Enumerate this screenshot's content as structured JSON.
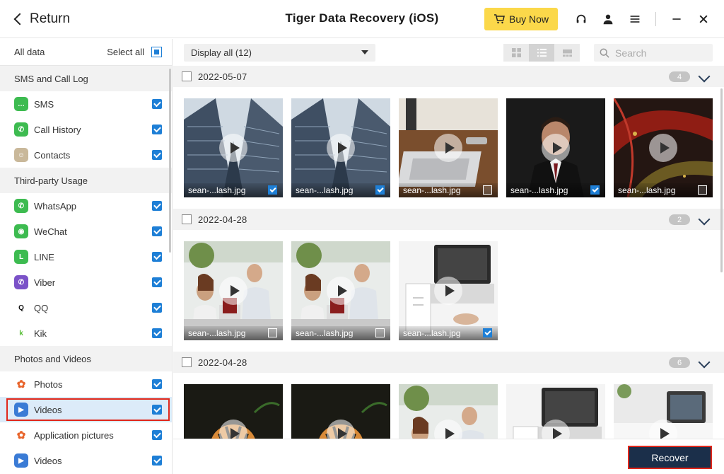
{
  "window": {
    "title": "Tiger Data Recovery (iOS)",
    "return_label": "Return",
    "buy_now_label": "Buy Now",
    "icons": [
      "headset-icon",
      "user-icon",
      "menu-icon",
      "minimize-icon",
      "close-icon"
    ]
  },
  "sidebar": {
    "all_data_label": "All data",
    "select_all_label": "Select all",
    "sections": [
      {
        "title": "SMS and Call Log",
        "items": [
          {
            "label": "SMS",
            "icon": "sms-icon",
            "color": "#3dbb50",
            "checked": true
          },
          {
            "label": "Call History",
            "icon": "phone-icon",
            "color": "#3dbb50",
            "checked": true
          },
          {
            "label": "Contacts",
            "icon": "contacts-icon",
            "color": "#c9b89a",
            "checked": true
          }
        ]
      },
      {
        "title": "Third-party Usage",
        "items": [
          {
            "label": "WhatsApp",
            "icon": "whatsapp-icon",
            "color": "#3dbb50",
            "checked": true
          },
          {
            "label": "WeChat",
            "icon": "wechat-icon",
            "color": "#3dbb50",
            "checked": true
          },
          {
            "label": "LINE",
            "icon": "line-icon",
            "color": "#3dbb50",
            "checked": true
          },
          {
            "label": "Viber",
            "icon": "viber-icon",
            "color": "#7b52c8",
            "checked": true
          },
          {
            "label": "QQ",
            "icon": "qq-icon",
            "color": "#111111",
            "checked": true
          },
          {
            "label": "Kik",
            "icon": "kik-icon",
            "color": "#5bbf3a",
            "checked": true
          }
        ]
      },
      {
        "title": "Photos and Videos",
        "items": [
          {
            "label": "Photos",
            "icon": "photos-icon",
            "color": "#f5a623",
            "checked": true
          },
          {
            "label": "Videos",
            "icon": "videos-icon",
            "color": "#3a7bd5",
            "checked": true,
            "active": true
          },
          {
            "label": "Application pictures",
            "icon": "app-pictures-icon",
            "color": "#f5a623",
            "checked": true
          },
          {
            "label": "Videos",
            "icon": "videos-icon",
            "color": "#3a7bd5",
            "checked": true
          }
        ]
      }
    ]
  },
  "toolbar": {
    "display_label": "Display all (12)",
    "search_placeholder": "Search"
  },
  "groups": [
    {
      "date": "2022-05-07",
      "count": "4",
      "items": [
        {
          "name": "sean-...lash.jpg",
          "checked": true,
          "scene": "building"
        },
        {
          "name": "sean-...lash.jpg",
          "checked": true,
          "scene": "building"
        },
        {
          "name": "sean-...lash.jpg",
          "checked": false,
          "scene": "laptop-desk"
        },
        {
          "name": "sean-...lash.jpg",
          "checked": true,
          "scene": "man-suit"
        },
        {
          "name": "sean-...lash.jpg",
          "checked": false,
          "scene": "red-abstract"
        }
      ]
    },
    {
      "date": "2022-04-28",
      "count": "2",
      "items": [
        {
          "name": "sean-...lash.jpg",
          "checked": false,
          "scene": "office"
        },
        {
          "name": "sean-...lash.jpg",
          "checked": false,
          "scene": "office"
        },
        {
          "name": "sean-...lash.jpg",
          "checked": true,
          "scene": "laptop-white"
        }
      ]
    },
    {
      "date": "2022-04-28",
      "count": "6",
      "items": [
        {
          "name": "",
          "checked": false,
          "scene": "tiger"
        },
        {
          "name": "",
          "checked": false,
          "scene": "tiger"
        },
        {
          "name": "",
          "checked": false,
          "scene": "office"
        },
        {
          "name": "",
          "checked": false,
          "scene": "laptop-white"
        },
        {
          "name": "",
          "checked": false,
          "scene": "laptop-desk2"
        }
      ]
    }
  ],
  "footer": {
    "recover_label": "Recover"
  }
}
